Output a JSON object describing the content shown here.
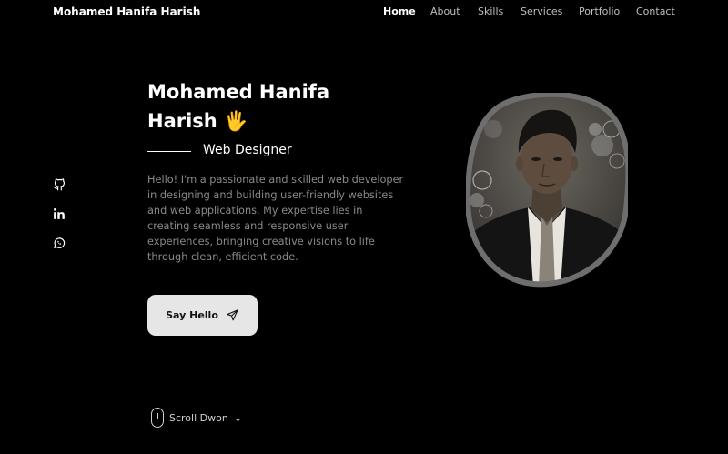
{
  "header": {
    "brand": "Mohamed Hanifa Harish",
    "nav": [
      "Home",
      "About",
      "Skills",
      "Services",
      "Portfolio",
      "Contact"
    ],
    "active": "Home"
  },
  "socials": [
    {
      "icon": "github-icon"
    },
    {
      "icon": "linkedin-icon"
    },
    {
      "icon": "whatsapp-icon"
    }
  ],
  "hero": {
    "name_line1": "Mohamed Hanifa",
    "name_line2": "Harish",
    "wave": "🖐",
    "role": "Web Designer",
    "bio": "Hello! I'm a passionate and skilled web developer in designing and building user-friendly websites and web applications. My expertise lies in creating seamless and responsive user experiences, bringing creative visions to life through clean, efficient code.",
    "cta_label": "Say Hello"
  },
  "scroll": {
    "label": "Scroll Dwon",
    "arrow": "↓"
  },
  "colors": {
    "background": "#000000",
    "text": "#ffffff",
    "muted": "#8a8a8a",
    "button_bg": "#e6e6e6",
    "portrait_border": "#6e6e6e"
  }
}
